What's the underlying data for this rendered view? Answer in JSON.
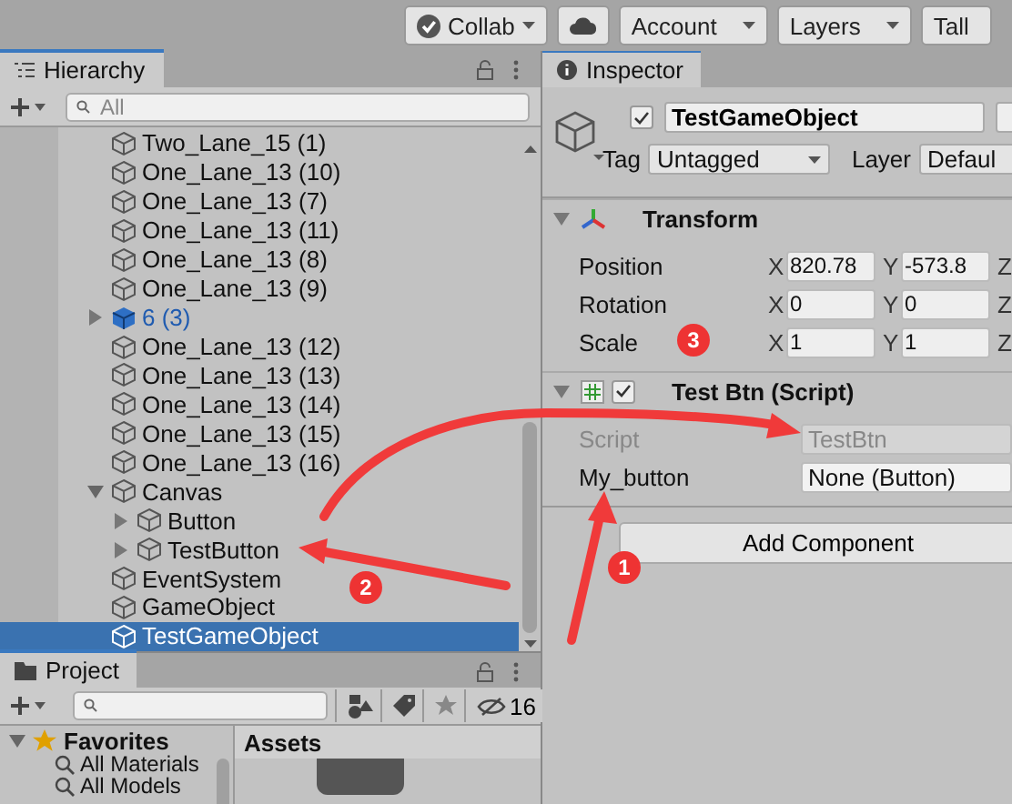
{
  "toolbar": {
    "buttons": [
      {
        "kind": "collab",
        "label": "Collab"
      },
      {
        "kind": "cloud"
      },
      {
        "kind": "dropdown",
        "label": "Account"
      },
      {
        "kind": "dropdown",
        "label": "Layers"
      },
      {
        "kind": "plain",
        "label": "Tall"
      }
    ]
  },
  "hierarchy": {
    "title": "Hierarchy",
    "search": {
      "placeholder": "All"
    },
    "items": [
      {
        "name": "Two_Lane_15 (1)",
        "kind": "object",
        "selected": false
      },
      {
        "name": "One_Lane_13 (10)",
        "kind": "object",
        "selected": false
      },
      {
        "name": "One_Lane_13 (7)",
        "kind": "object",
        "selected": false
      },
      {
        "name": "One_Lane_13 (11)",
        "kind": "object",
        "selected": false
      },
      {
        "name": "One_Lane_13 (8)",
        "kind": "object",
        "selected": false
      },
      {
        "name": "One_Lane_13 (9)",
        "kind": "object",
        "selected": false
      },
      {
        "name": "6 (3)",
        "kind": "prefab",
        "expanded": false,
        "selected": false
      },
      {
        "name": "One_Lane_13 (12)",
        "kind": "object",
        "selected": false
      },
      {
        "name": "One_Lane_13 (13)",
        "kind": "object",
        "selected": false
      },
      {
        "name": "One_Lane_13 (14)",
        "kind": "object",
        "selected": false
      },
      {
        "name": "One_Lane_13 (15)",
        "kind": "object",
        "selected": false
      },
      {
        "name": "One_Lane_13 (16)",
        "kind": "object",
        "selected": false
      },
      {
        "name": "Canvas",
        "kind": "object",
        "expanded": true,
        "selected": false,
        "children": [
          {
            "name": "Button",
            "kind": "object",
            "expanded": false,
            "selected": false
          },
          {
            "name": "TestButton",
            "kind": "object",
            "expanded": false,
            "selected": false
          }
        ]
      },
      {
        "name": "EventSystem",
        "kind": "object",
        "selected": false
      },
      {
        "name": "GameObject",
        "kind": "object",
        "selected": false
      },
      {
        "name": "TestGameObject",
        "kind": "object",
        "selected": true
      }
    ]
  },
  "project": {
    "title": "Project",
    "hidden_count": "16",
    "favorites": {
      "label": "Favorites",
      "expanded": true,
      "items": [
        "All Materials",
        "All Models"
      ]
    },
    "assets_title": "Assets"
  },
  "inspector": {
    "title": "Inspector",
    "object": {
      "active": true,
      "name": "TestGameObject",
      "static": false,
      "tag_label": "Tag",
      "tag": "Untagged",
      "layer_label": "Layer",
      "layer": "Defaul"
    },
    "components": [
      {
        "kind": "transform",
        "title": "Transform",
        "expanded": true,
        "rows": [
          {
            "label": "Position",
            "values": [
              {
                "axis": "X",
                "value": "820.78"
              },
              {
                "axis": "Y",
                "value": "-573.8"
              },
              {
                "axis": "Z"
              }
            ]
          },
          {
            "label": "Rotation",
            "values": [
              {
                "axis": "X",
                "value": "0"
              },
              {
                "axis": "Y",
                "value": "0"
              },
              {
                "axis": "Z"
              }
            ]
          },
          {
            "label": "Scale",
            "values": [
              {
                "axis": "X",
                "value": "1"
              },
              {
                "axis": "Y",
                "value": "1"
              },
              {
                "axis": "Z"
              }
            ]
          }
        ]
      },
      {
        "kind": "script",
        "title": "Test Btn (Script)",
        "expanded": true,
        "enabled": true,
        "fields": [
          {
            "label": "Script",
            "value": "TestBtn",
            "disabled": true
          },
          {
            "label": "My_button",
            "value": "None (Button)",
            "disabled": false
          }
        ]
      }
    ],
    "add_component": "Add Component"
  },
  "annotations": [
    {
      "label": "1"
    },
    {
      "label": "2"
    },
    {
      "label": "3"
    }
  ]
}
